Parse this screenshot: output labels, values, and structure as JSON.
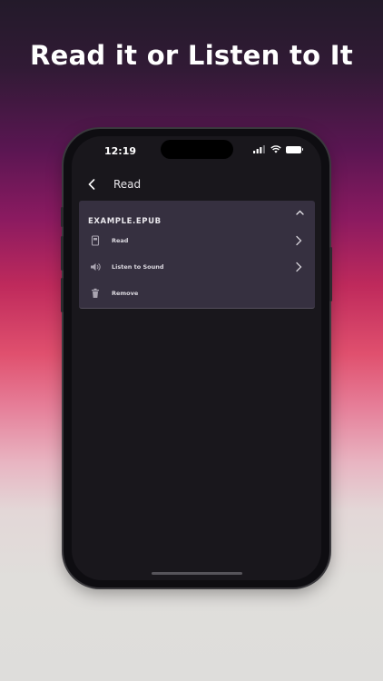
{
  "headline": "Read it or Listen to It",
  "status_bar": {
    "time": "12:19"
  },
  "nav": {
    "title": "Read",
    "back_icon": "chevron-left-icon"
  },
  "file_panel": {
    "title": "EXAMPLE.EPUB",
    "collapse_icon": "chevron-up-icon",
    "actions": [
      {
        "label": "Read",
        "icon": "book-icon",
        "has_chevron": true
      },
      {
        "label": "Listen to Sound",
        "icon": "speaker-icon",
        "has_chevron": true
      },
      {
        "label": "Remove",
        "icon": "trash-icon",
        "has_chevron": false
      }
    ]
  },
  "colors": {
    "panel_bg": "#363040",
    "screen_bg": "#19171c",
    "text": "#dcd9e0"
  }
}
